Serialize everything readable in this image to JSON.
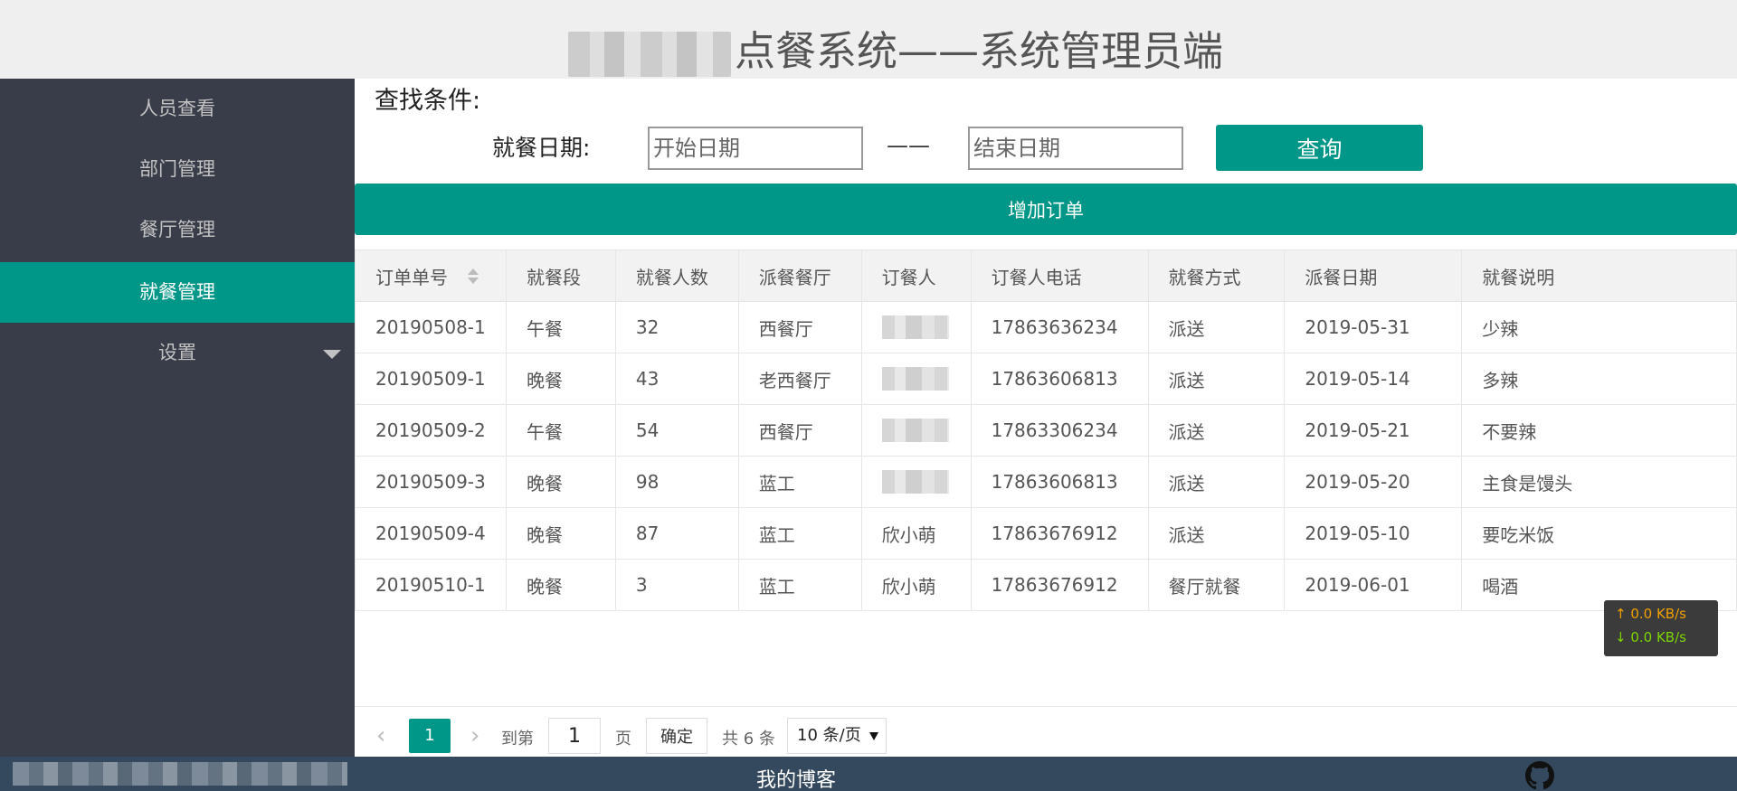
{
  "header": {
    "title": "点餐系统——系统管理员端"
  },
  "sidebar": {
    "items": [
      {
        "label": "人员查看"
      },
      {
        "label": "部门管理"
      },
      {
        "label": "餐厅管理"
      },
      {
        "label": "就餐管理",
        "active": true
      },
      {
        "label": "设置"
      }
    ]
  },
  "search": {
    "heading": "查找条件:",
    "date_label": "就餐日期:",
    "start_placeholder": "开始日期",
    "separator": "——",
    "end_placeholder": "结束日期",
    "query_label": "查询"
  },
  "add_order_label": "增加订单",
  "table": {
    "columns": [
      "订单单号",
      "就餐段",
      "就餐人数",
      "派餐餐厅",
      "订餐人",
      "订餐人电话",
      "就餐方式",
      "派餐日期",
      "就餐说明"
    ],
    "rows": [
      [
        "20190508-1",
        "午餐",
        "32",
        "西餐厅",
        "",
        "17863636234",
        "派送",
        "2019-05-31",
        "少辣"
      ],
      [
        "20190509-1",
        "晚餐",
        "43",
        "老西餐厅",
        "",
        "17863606813",
        "派送",
        "2019-05-14",
        "多辣"
      ],
      [
        "20190509-2",
        "午餐",
        "54",
        "西餐厅",
        "",
        "17863306234",
        "派送",
        "2019-05-21",
        "不要辣"
      ],
      [
        "20190509-3",
        "晚餐",
        "98",
        "蓝工",
        "",
        "17863606813",
        "派送",
        "2019-05-20",
        "主食是馒头"
      ],
      [
        "20190509-4",
        "晚餐",
        "87",
        "蓝工",
        "欣小萌",
        "17863676912",
        "派送",
        "2019-05-10",
        "要吃米饭"
      ],
      [
        "20190510-1",
        "晚餐",
        "3",
        "蓝工",
        "欣小萌",
        "17863676912",
        "餐厅就餐",
        "2019-06-01",
        "喝酒"
      ]
    ]
  },
  "pager": {
    "prev": "‹",
    "current_page": "1",
    "next": "›",
    "goto_label": "到第",
    "goto_value": "1",
    "page_unit": "页",
    "confirm_label": "确定",
    "total_label": "共 6 条",
    "page_size": "10 条/页"
  },
  "speed": {
    "up": "↑ 0.0 KB/s",
    "down": "↓ 0.0 KB/s"
  },
  "footer": {
    "blog_label": "我的博客"
  },
  "colors": {
    "accent": "#009688",
    "sidebar": "#393d49",
    "footer": "#34495e"
  }
}
